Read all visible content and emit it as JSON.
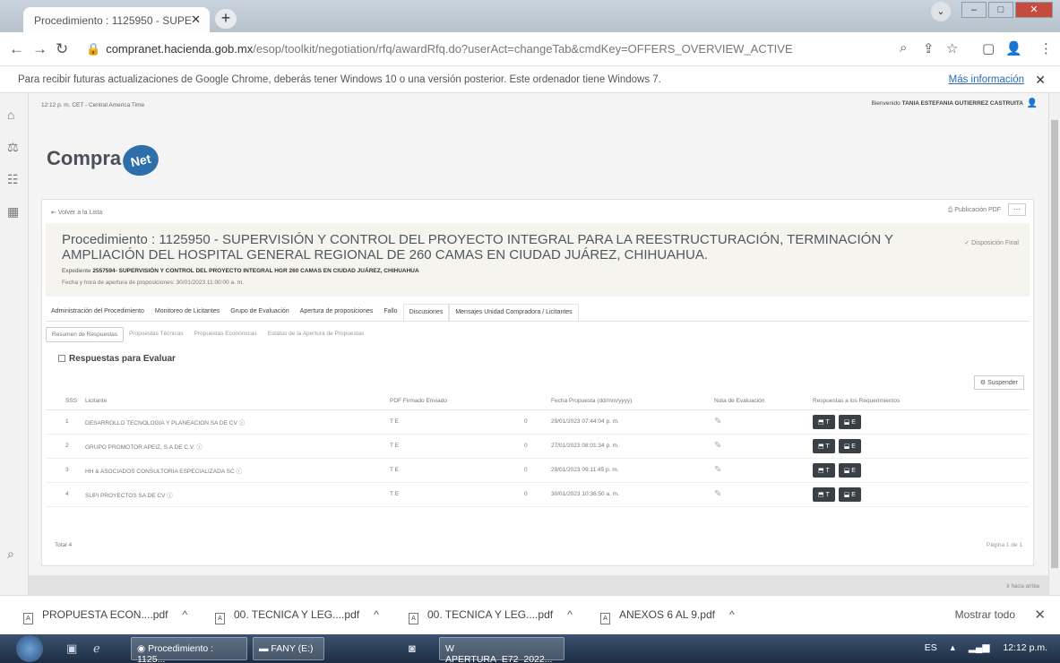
{
  "browser": {
    "tab_title": "Procedimiento : 1125950 - SUPE",
    "tab_close": "✕",
    "new_tab": "+",
    "url_host": "compranet.hacienda.gob.mx",
    "url_path": "/esop/toolkit/negotiation/rfq/awardRfq.do?userAct=changeTab&cmdKey=OFFERS_OVERVIEW_ACTIVE",
    "infobar_text": "Para recibir futuras actualizaciones de Google Chrome, deberás tener Windows 10 o una versión posterior. Este ordenador tiene Windows 7.",
    "infobar_link": "Más información",
    "infobar_close": "✕"
  },
  "page": {
    "timezone": "12:12 p. m. CET - Central America Time",
    "welcome_prefix": "Bienvenido",
    "user_name": "TANIA ESTEFANIA GUTIERREZ CASTRUITA",
    "logo_text": "Compra",
    "logo_net": "Net",
    "back_link": "Volver a la Lista",
    "publish_pdf": "Publicación PDF",
    "menu_dots": "···",
    "title": "Procedimiento : 1125950 - SUPERVISIÓN Y CONTROL DEL PROYECTO INTEGRAL PARA LA REESTRUCTURACIÓN, TERMINACIÓN Y AMPLIACIÓN DEL HOSPITAL GENERAL REGIONAL DE 260 CAMAS EN CIUDAD JUÁREZ, CHIHUAHUA.",
    "expediente_label": "Expediente",
    "expediente_value": "2557594- SUPERVISIÓN Y CONTROL DEL PROYECTO INTEGRAL HGR 260 CAMAS EN CIUDAD JUÁREZ, CHIHUAHUA",
    "fecha_apertura": "Fecha y hora de apertura de proposiciones: 30/01/2023 11:00:00 a. m.",
    "disposicion": "Disposición Final",
    "tabs": [
      "Administración del Procedimiento",
      "Monitoreo de Licitantes",
      "Grupo de Evaluación",
      "Apertura de proposiciones",
      "Fallo",
      "Discusiones",
      "Mensajes Unidad Compradora / Licitantes"
    ],
    "subtabs": [
      "Resumen de Respuestas",
      "Propuestas Técnicas",
      "Propuestas Económicas",
      "Estatus de la Apertura de Propuestas"
    ],
    "section_title": "Respuestas para Evaluar",
    "suspender": "Suspender",
    "columns": [
      "SSS",
      "Licitante",
      "PDF Firmado Enviado",
      "",
      "Fecha Propuesta (dd/mm/yyyy)",
      "Nota de Evaluación",
      "Respuestas a los Requerimientos"
    ],
    "rows": [
      {
        "n": "1",
        "name": "DESARROLLO TECNOLOGIA Y PLANEACION SA DE CV",
        "pdf": "T E",
        "zero": "0",
        "fecha": "29/01/2023 07:44:04 p. m."
      },
      {
        "n": "2",
        "name": "GRUPO PROMOTOR APEIZ, S.A DE C.V.",
        "pdf": "T E",
        "zero": "0",
        "fecha": "27/01/2023 08:01:34 p. m."
      },
      {
        "n": "3",
        "name": "HH & ASOCIADOS CONSULTORIA ESPECIALIZADA SC",
        "pdf": "T E",
        "zero": "0",
        "fecha": "29/01/2023 09:11:45 p. m."
      },
      {
        "n": "4",
        "name": "SUPI PROYECTOS SA DE CV",
        "pdf": "T E",
        "zero": "0",
        "fecha": "30/01/2023 10:36:50 a. m."
      }
    ],
    "btn_t": "T",
    "btn_e": "E",
    "total": "Total 4",
    "pager": "Página 1 de 1",
    "footer_right": "Ir hacia arriba"
  },
  "downloads": [
    "PROPUESTA ECON....pdf",
    "00. TECNICA Y LEG....pdf",
    "00. TECNICA Y LEG....pdf",
    "ANEXOS 6 AL 9.pdf"
  ],
  "downloads_show_all": "Mostrar todo",
  "taskbar": {
    "task_chrome": "Procedimiento : 1125...",
    "task_folder": "FANY (E:)",
    "task_word": "APERTURA_E72_2022...",
    "lang": "ES",
    "clock": "12:12 p.m."
  },
  "colors": {
    "accent": "#2c6faa",
    "dark_button": "#3b3f46",
    "hero_bg": "#f5f4ef"
  }
}
